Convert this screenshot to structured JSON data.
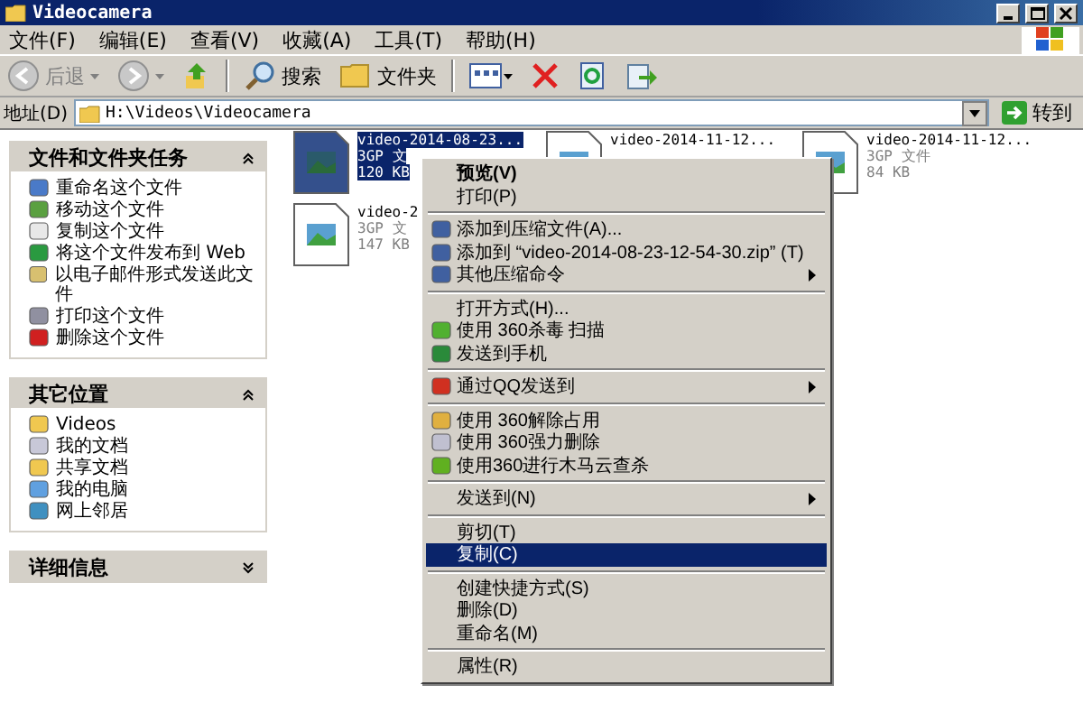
{
  "window": {
    "title": "Videocamera"
  },
  "menu_bar": [
    "文件(F)",
    "编辑(E)",
    "查看(V)",
    "收藏(A)",
    "工具(T)",
    "帮助(H)"
  ],
  "toolbar": {
    "back": "后退",
    "search": "搜索",
    "folders": "文件夹"
  },
  "address_bar": {
    "label": "地址(D)",
    "value": "H:\\Videos\\Videocamera",
    "go": "转到"
  },
  "sidebar": [
    {
      "title": "文件和文件夹任务",
      "expanded": true,
      "items": [
        "重命名这个文件",
        "移动这个文件",
        "复制这个文件",
        "将这个文件发布到 Web",
        "以电子邮件形式发送此文件",
        "打印这个文件",
        "删除这个文件"
      ]
    },
    {
      "title": "其它位置",
      "expanded": true,
      "items": [
        "Videos",
        "我的文档",
        "共享文档",
        "我的电脑",
        "网上邻居"
      ]
    },
    {
      "title": "详细信息",
      "expanded": false
    }
  ],
  "files": [
    {
      "name": "video-2014-08-23...",
      "type": "3GP 文",
      "size": "120 KB",
      "selected": true
    },
    {
      "name": "video-2014-11-12...",
      "selected": false
    },
    {
      "name": "video-2014-11-12...",
      "type": "3GP 文件",
      "size": "84 KB",
      "selected": false
    },
    {
      "name": "video-2",
      "type": "3GP 文",
      "size": "147 KB",
      "selected": false
    }
  ],
  "context_menu": [
    {
      "kind": "item",
      "label": "预览(V)",
      "default": true,
      "selected": false
    },
    {
      "kind": "item",
      "label": "打印(P)",
      "selected": false
    },
    {
      "kind": "separator"
    },
    {
      "kind": "icon",
      "label": "添加到压缩文件(A)...",
      "selected": false
    },
    {
      "kind": "icon",
      "label": "添加到 “video-2014-08-23-12-54-30.zip” (T)",
      "selected": false
    },
    {
      "kind": "icon",
      "label": "其他压缩命令",
      "submenu": true,
      "selected": false
    },
    {
      "kind": "separator"
    },
    {
      "kind": "item",
      "label": "打开方式(H)...",
      "selected": false
    },
    {
      "kind": "icon",
      "label": "使用 360杀毒 扫描",
      "selected": false
    },
    {
      "kind": "icon",
      "label": "发送到手机",
      "selected": false
    },
    {
      "kind": "separator"
    },
    {
      "kind": "icon",
      "label": "通过QQ发送到",
      "submenu": true,
      "selected": false
    },
    {
      "kind": "separator"
    },
    {
      "kind": "icon",
      "label": "使用 360解除占用",
      "selected": false
    },
    {
      "kind": "icon",
      "label": "使用 360强力删除",
      "selected": false
    },
    {
      "kind": "icon",
      "label": "使用360进行木马云查杀",
      "selected": false
    },
    {
      "kind": "separator"
    },
    {
      "kind": "item",
      "label": "发送到(N)",
      "submenu": true,
      "selected": false
    },
    {
      "kind": "separator"
    },
    {
      "kind": "item",
      "label": "剪切(T)",
      "selected": false
    },
    {
      "kind": "item",
      "label": "复制(C)",
      "selected": true
    },
    {
      "kind": "separator"
    },
    {
      "kind": "item",
      "label": "创建快捷方式(S)",
      "selected": false
    },
    {
      "kind": "item",
      "label": "删除(D)",
      "selected": false
    },
    {
      "kind": "item",
      "label": "重命名(M)",
      "selected": false
    },
    {
      "kind": "separator"
    },
    {
      "kind": "item",
      "label": "属性(R)",
      "selected": false
    }
  ]
}
